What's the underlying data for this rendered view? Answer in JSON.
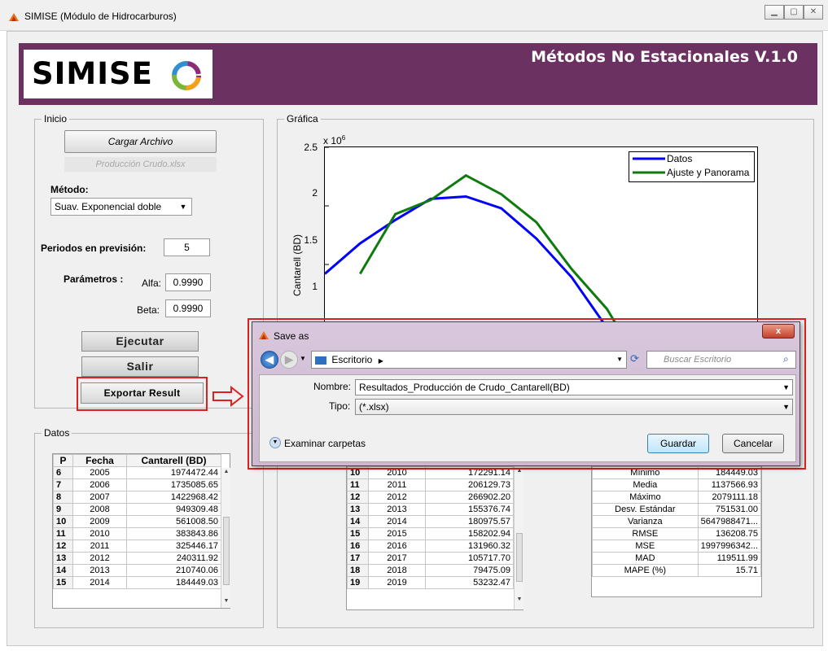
{
  "window": {
    "title": "SIMISE (Módulo de Hidrocarburos)"
  },
  "header": {
    "logo": "SIMISE",
    "title": "Métodos No Estacionales V.1.0"
  },
  "inicio": {
    "label": "Inicio",
    "load_button": "Cargar Archivo",
    "file_name": "Producción Crudo.xlsx",
    "method_label": "Método:",
    "method_value": "Suav. Exponencial doble",
    "periods_label": "Periodos en previsión:",
    "periods_value": "5",
    "params_label": "Parámetros :",
    "alfa_label": "Alfa:",
    "alfa_value": "0.9990",
    "beta_label": "Beta:",
    "beta_value": "0.9990",
    "run_button": "Ejecutar",
    "exit_button": "Salir",
    "export_button": "Exportar Result"
  },
  "grafica": {
    "label": "Gráfica",
    "exponent": "x 10",
    "exponent_power": "6"
  },
  "chart_data": {
    "type": "line",
    "ylabel": "Cantarell (BD)",
    "ylim": [
      0,
      2500000
    ],
    "yticks": [
      "2.5",
      "2",
      "1.5",
      "1"
    ],
    "legend_position": "top-right",
    "series": [
      {
        "name": "Datos",
        "color": "#0000ff",
        "x": [
          0,
          1,
          2,
          3,
          4,
          5,
          6,
          7,
          8,
          9,
          10,
          11,
          12,
          13,
          14,
          15,
          16,
          17,
          18,
          19
        ],
        "values": [
          1420000,
          1680000,
          1880000,
          2060000,
          2080000,
          1980000,
          1720000,
          1390000,
          960000,
          640000,
          420000,
          340000,
          300000,
          240000,
          210000,
          190000,
          180000,
          170000,
          165000,
          160000
        ]
      },
      {
        "name": "Ajuste y Panorama",
        "color": "#0f7b0f",
        "x": [
          1,
          2,
          3,
          4,
          5,
          6,
          7,
          8,
          9,
          10,
          11,
          12,
          13,
          14,
          15,
          16,
          17,
          18,
          19
        ],
        "values": [
          1420000,
          1930000,
          2050000,
          2260000,
          2100000,
          1860000,
          1460000,
          1120000,
          620000,
          330000,
          280000,
          250000,
          190000,
          160000,
          140000,
          120000,
          110000,
          100000,
          90000
        ]
      }
    ]
  },
  "datos": {
    "label": "Datos",
    "columns": [
      "P",
      "Fecha",
      "Cantarell (BD)"
    ],
    "rows": [
      [
        "6",
        "2005",
        "1974472.44"
      ],
      [
        "7",
        "2006",
        "1735085.65"
      ],
      [
        "8",
        "2007",
        "1422968.42"
      ],
      [
        "9",
        "2008",
        "949309.48"
      ],
      [
        "10",
        "2009",
        "561008.50"
      ],
      [
        "11",
        "2010",
        "383843.86"
      ],
      [
        "12",
        "2011",
        "325446.17"
      ],
      [
        "13",
        "2012",
        "240311.92"
      ],
      [
        "14",
        "2013",
        "210740.06"
      ],
      [
        "15",
        "2014",
        "184449.03"
      ]
    ]
  },
  "forecast_table": {
    "rows": [
      [
        "10",
        "2010",
        "172291.14"
      ],
      [
        "11",
        "2011",
        "206129.73"
      ],
      [
        "12",
        "2012",
        "266902.20"
      ],
      [
        "13",
        "2013",
        "155376.74"
      ],
      [
        "14",
        "2014",
        "180975.57"
      ],
      [
        "15",
        "2015",
        "158202.94"
      ],
      [
        "16",
        "2016",
        "131960.32"
      ],
      [
        "17",
        "2017",
        "105717.70"
      ],
      [
        "18",
        "2018",
        "79475.09"
      ],
      [
        "19",
        "2019",
        "53232.47"
      ]
    ]
  },
  "stats_table": {
    "rows": [
      [
        "Mínimo",
        "184449.03"
      ],
      [
        "Media",
        "1137566.93"
      ],
      [
        "Máximo",
        "2079111.18"
      ],
      [
        "Desv. Estándar",
        "751531.00"
      ],
      [
        "Varianza",
        "5647988471..."
      ],
      [
        "RMSE",
        "136208.75"
      ],
      [
        "MSE",
        "1997996342..."
      ],
      [
        "MAD",
        "119511.99"
      ],
      [
        "MAPE (%)",
        "15.71"
      ]
    ]
  },
  "dialog": {
    "title": "Save as",
    "close": "x",
    "location": "Escritorio",
    "search_placeholder": "Buscar Escritorio",
    "name_label": "Nombre:",
    "name_value": "Resultados_Producción de Crudo_Cantarell(BD)",
    "type_label": "Tipo:",
    "type_value": "(*.xlsx)",
    "browse_folders": "Examinar carpetas",
    "save_button": "Guardar",
    "cancel_button": "Cancelar"
  },
  "colors": {
    "header_bg": "#6b3160",
    "series_datos": "#0000ff",
    "series_ajuste": "#0f7b0f",
    "highlight": "#e02020"
  }
}
